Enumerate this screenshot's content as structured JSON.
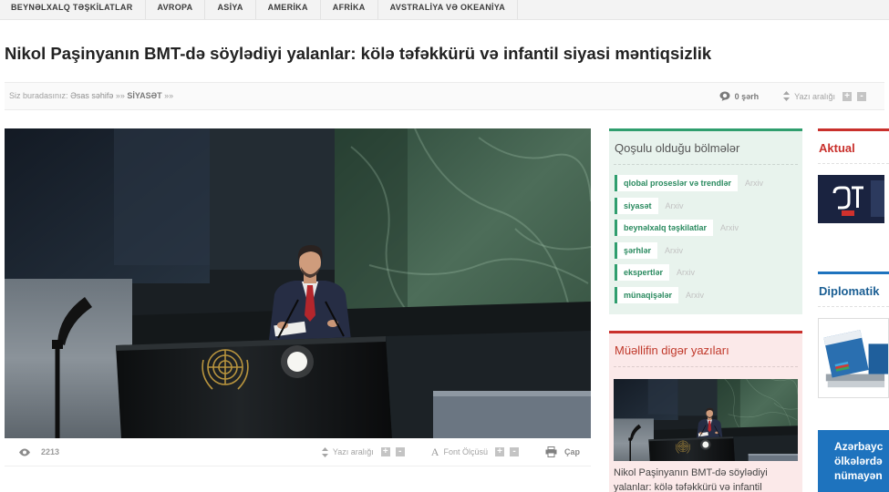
{
  "nav": {
    "items": [
      "BEYNƏLXALQ TƏŞKİLATLAR",
      "AVROPA",
      "ASİYA",
      "AMERİKA",
      "AFRİKA",
      "AVSTRALİYA VƏ OKEANİYA"
    ]
  },
  "article": {
    "title": "Nikol Paşinyanın BMT-də söylədiyi yalanlar: kölə təfəkkürü və infantil siyasi məntiqsizlik",
    "comments": "0 şərh",
    "views": "2213"
  },
  "breadcrumb": {
    "prefix": "Siz buradasınız:",
    "home": "Əsas səhifə",
    "separator": "»»",
    "section": "SİYASƏT"
  },
  "controls": {
    "line_spacing_label": "Yazı aralığı",
    "font_glyph": "A",
    "font_size_label": "Font Ölçüsü",
    "print_label": "Çap",
    "plus": "+",
    "minus": "-"
  },
  "sections_box": {
    "title": "Qoşulu olduğu bölmələr",
    "archive_label": "Arxiv",
    "items": [
      "qlobal proseslər və trendlər",
      "siyasət",
      "beynəlxalq təşkilatlar",
      "şərhlər",
      "ekspertlər",
      "münaqişələr"
    ]
  },
  "author_box": {
    "title": "Müəllifin digər yazıları",
    "article_title": "Nikol Paşinyanın BMT-də söylədiyi yalanlar: kölə təfəkkürü və infantil"
  },
  "aktual": {
    "title": "Aktual"
  },
  "diplomatik": {
    "title": "Diplomatik",
    "promo_lines": [
      "Azərbayc",
      "ölkələrdə",
      "nümayən"
    ]
  },
  "colors": {
    "green_accent": "#2f9e6e",
    "red_accent": "#c9302c",
    "blue_accent": "#1e73be",
    "sections_bg": "#e8f3ed",
    "author_bg": "#fbe9e9"
  },
  "icons": {
    "comments": "comment-icon",
    "line_spacing": "updown-arrows-icon",
    "views": "eye-icon",
    "print": "printer-icon"
  }
}
